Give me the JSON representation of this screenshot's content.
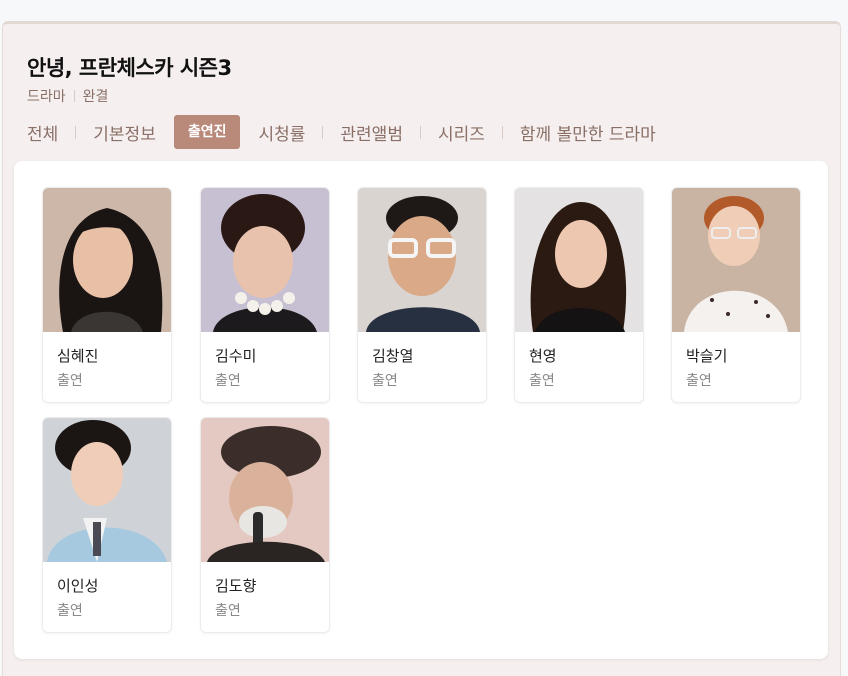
{
  "header": {
    "title": "안녕, 프란체스카 시즌3",
    "genre": "드라마",
    "status": "완결"
  },
  "tabs": [
    {
      "label": "전체",
      "active": false
    },
    {
      "label": "기본정보",
      "active": false
    },
    {
      "label": "출연진",
      "active": true
    },
    {
      "label": "시청률",
      "active": false
    },
    {
      "label": "관련앨범",
      "active": false
    },
    {
      "label": "시리즈",
      "active": false
    },
    {
      "label": "함께 볼만한 드라마",
      "active": false
    }
  ],
  "cast": [
    {
      "name": "심혜진",
      "role": "출연"
    },
    {
      "name": "김수미",
      "role": "출연"
    },
    {
      "name": "김창열",
      "role": "출연"
    },
    {
      "name": "현영",
      "role": "출연"
    },
    {
      "name": "박슬기",
      "role": "출연"
    },
    {
      "name": "이인성",
      "role": "출연"
    },
    {
      "name": "김도향",
      "role": "출연"
    }
  ]
}
